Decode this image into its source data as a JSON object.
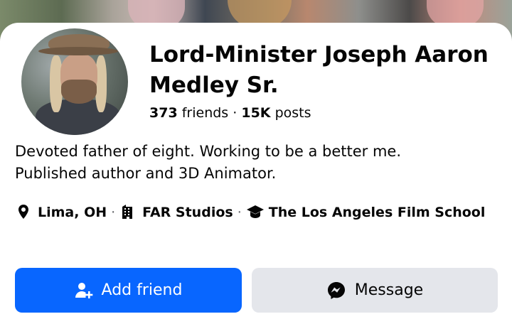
{
  "profile": {
    "name": "Lord-Minister Joseph Aaron Medley Sr.",
    "friends_count": "373",
    "friends_label": "friends",
    "separator": "·",
    "posts_count": "15K",
    "posts_label": "posts",
    "bio_line1": "Devoted father of eight. Working to be a better me.",
    "bio_line2": "Published author and 3D Animator."
  },
  "details": {
    "location": "Lima, OH",
    "work": "FAR Studios",
    "education": "The Los Angeles Film School"
  },
  "actions": {
    "add_friend_label": "Add friend",
    "message_label": "Message"
  },
  "icons": {
    "location": "location-pin-icon",
    "work": "building-icon",
    "education": "graduation-cap-icon",
    "add_friend": "add-friend-icon",
    "message": "messenger-icon"
  },
  "colors": {
    "primary_button": "#0866ff",
    "secondary_button": "#e4e6eb",
    "text": "#050505"
  }
}
